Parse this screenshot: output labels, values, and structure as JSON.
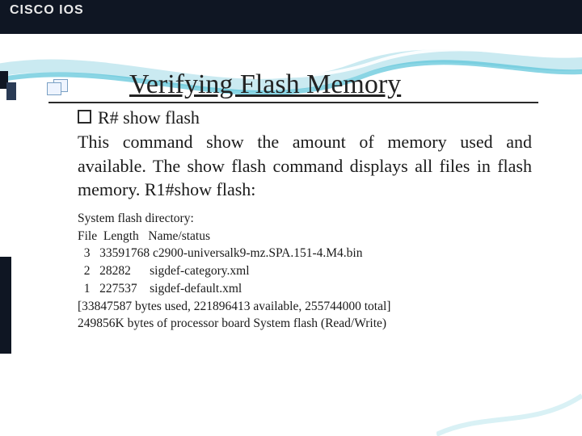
{
  "header": {
    "label": "CISCO IOS"
  },
  "title": "Verifying Flash Memory",
  "bullet": "R# show flash",
  "paragraph": "This command show the amount of memory used and available. The show flash command displays all files in flash memory. R1#show flash:",
  "terminal": {
    "line1": "System flash directory:",
    "header_row": "File  Length   Name/status",
    "rows": [
      {
        "num": "3",
        "len": "33591768",
        "name": "c2900-universalk9-mz.SPA.151-4.M4.bin"
      },
      {
        "num": "2",
        "len": "28282",
        "name": "sigdef-category.xml"
      },
      {
        "num": "1",
        "len": "227537",
        "name": "sigdef-default.xml"
      }
    ],
    "summary1": "[33847587 bytes used, 221896413 available, 255744000 total]",
    "summary2": "249856K bytes of processor board System flash (Read/Write)"
  },
  "chart_data": {
    "type": "table",
    "title": "System flash directory",
    "columns": [
      "File",
      "Length",
      "Name/status"
    ],
    "rows": [
      [
        3,
        33591768,
        "c2900-universalk9-mz.SPA.151-4.M4.bin"
      ],
      [
        2,
        28282,
        "sigdef-category.xml"
      ],
      [
        1,
        227537,
        "sigdef-default.xml"
      ]
    ],
    "totals": {
      "bytes_used": 33847587,
      "bytes_available": 221896413,
      "bytes_total": 255744000
    },
    "note": "249856K bytes of processor board System flash (Read/Write)"
  }
}
